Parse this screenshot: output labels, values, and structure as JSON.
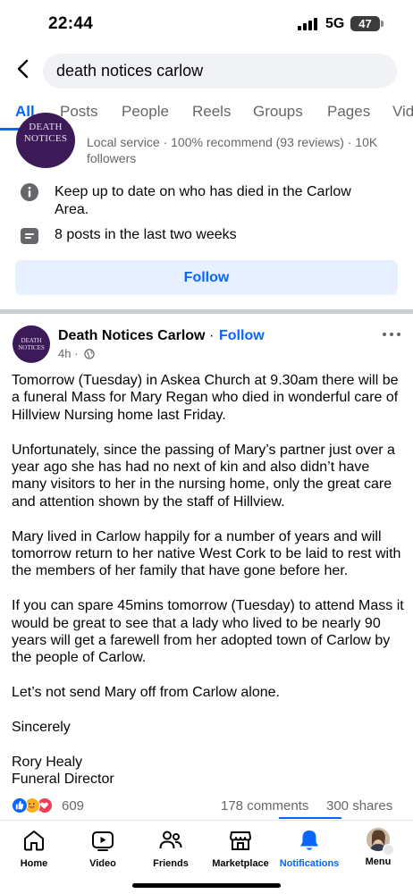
{
  "status_bar": {
    "time": "22:44",
    "network": "5G",
    "battery": "47"
  },
  "search": {
    "query": "death notices carlow"
  },
  "tabs": [
    {
      "label": "All",
      "active": true
    },
    {
      "label": "Posts"
    },
    {
      "label": "People"
    },
    {
      "label": "Reels"
    },
    {
      "label": "Groups"
    },
    {
      "label": "Pages"
    },
    {
      "label": "Vid"
    }
  ],
  "page_card": {
    "avatar_line1": "DEATH",
    "avatar_line2": "NOTICES",
    "meta": "Local service · 100% recommend (93 reviews) · 10K followers",
    "info_description": "Keep up to date on who has died in the Carlow Area.",
    "info_posts": "8 posts in the last two weeks",
    "follow_label": "Follow"
  },
  "post": {
    "author": "Death Notices Carlow",
    "separator": "·",
    "follow_label": "Follow",
    "time": "4h ·",
    "avatar_line1": "DEATH",
    "avatar_line2": "NOTICES",
    "body": {
      "p1": "Tomorrow (Tuesday) in Askea Church at 9.30am there will be a funeral Mass for Mary Regan who died in wonderful care of Hillview Nursing home last Friday.",
      "p2": "Unfortunately, since the passing of Mary’s partner just over a year ago she has had no next of kin and also didn’t have many visitors to her in the nursing home, only the great care and attention shown by the staff of Hillview.",
      "p3": "Mary lived in Carlow happily for a number of years and will tomorrow return to her native West Cork to be laid to rest with the members of her family that have gone before her.",
      "p4": "If you can spare 45mins tomorrow (Tuesday) to attend Mass it would be great to see that a lady who lived to be nearly 90 years will get a farewell from her adopted town of Carlow by the people of Carlow.",
      "p5": "Let’s not send Mary off from Carlow alone.",
      "p6": "Sincerely",
      "p7": "Rory Healy",
      "p8": "Funeral Director"
    },
    "reaction_count": "609",
    "comments": "178 comments",
    "shares": "300 shares",
    "reaction_icons": [
      "like-icon",
      "care-icon",
      "love-icon"
    ]
  },
  "bottom_nav": {
    "home": "Home",
    "video": "Video",
    "friends": "Friends",
    "marketplace": "Marketplace",
    "notifications": "Notifications",
    "menu": "Menu",
    "active": "notifications"
  },
  "colors": {
    "accent": "#0866ff",
    "secondary_text": "#65676b",
    "page_avatar": "#3b1a57"
  }
}
